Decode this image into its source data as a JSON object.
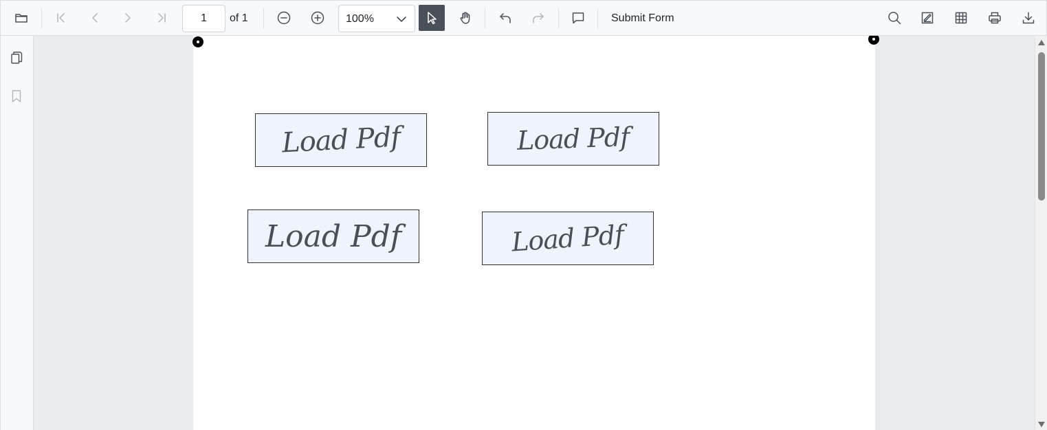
{
  "toolbar": {
    "icons": {
      "open": "folder-open-icon",
      "first_page": "first-page-icon",
      "previous_page": "previous-page-icon",
      "next_page": "next-page-icon",
      "last_page": "last-page-icon",
      "zoom_out": "zoom-out-icon",
      "zoom_in": "zoom-in-icon",
      "zoom_dropdown": "chevron-down-icon",
      "text_select": "cursor-select-icon",
      "pan": "hand-pan-icon",
      "undo": "undo-icon",
      "redo": "redo-icon",
      "comment": "comment-icon",
      "search": "search-icon",
      "annotation": "annotation-edit-icon",
      "form_designer": "form-designer-icon",
      "print": "print-icon",
      "download": "download-icon"
    },
    "page_number": "1",
    "page_count_label": "of 1",
    "zoom_value": "100%",
    "submit_form_label": "Submit Form"
  },
  "side_panel": {
    "icons": {
      "thumbnails": "page-thumbnails-icon",
      "bookmarks": "bookmark-icon"
    }
  },
  "document": {
    "signature_fields": [
      {
        "text": "Load Pdf"
      },
      {
        "text": "Load Pdf"
      },
      {
        "text": "Load Pdf"
      },
      {
        "text": "Load Pdf"
      }
    ]
  },
  "colors": {
    "toolbar_bg": "#f8f9fa",
    "canvas_bg": "#e9ecef",
    "active_tool_bg": "#495057",
    "signature_field_bg": "#eff4fc",
    "signature_ink": "#4a4e55"
  }
}
